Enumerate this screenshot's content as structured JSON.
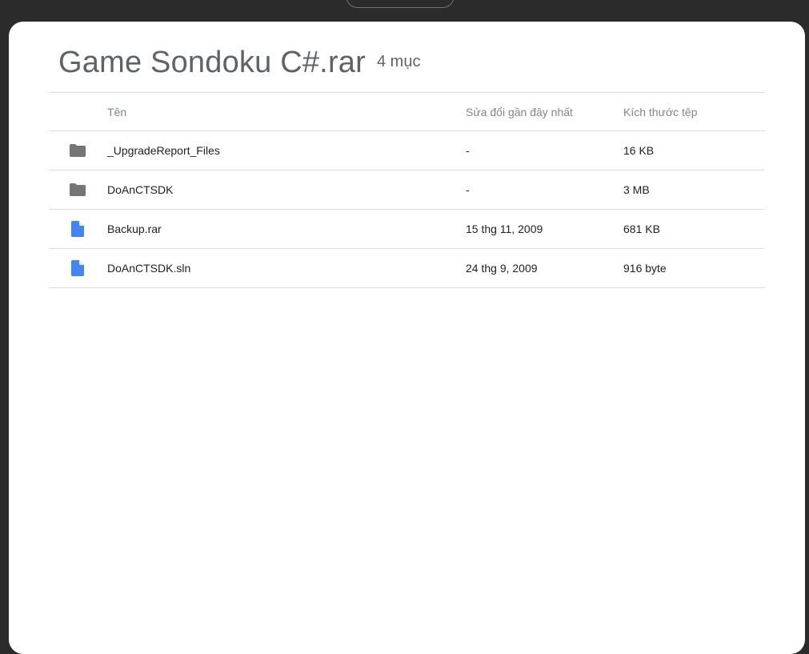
{
  "archive": {
    "title": "Game Sondoku C#.rar",
    "item_count": "4 mục"
  },
  "table": {
    "headers": {
      "name": "Tên",
      "modified": "Sửa đổi gần đây nhất",
      "size": "Kích thước tệp"
    },
    "rows": [
      {
        "icon": "folder-icon",
        "name": "_UpgradeReport_Files",
        "modified": "-",
        "size": "16 KB"
      },
      {
        "icon": "folder-icon",
        "name": "DoAnCTSDK",
        "modified": "-",
        "size": "3 MB"
      },
      {
        "icon": "file-icon",
        "name": "Backup.rar",
        "modified": "15 thg 11, 2009",
        "size": "681 KB"
      },
      {
        "icon": "file-icon",
        "name": "DoAnCTSDK.sln",
        "modified": "24 thg 9, 2009",
        "size": "916 byte"
      }
    ]
  },
  "colors": {
    "background": "#2b2b2b",
    "card": "#ffffff",
    "folder": "#757575",
    "file": "#4285f4"
  }
}
